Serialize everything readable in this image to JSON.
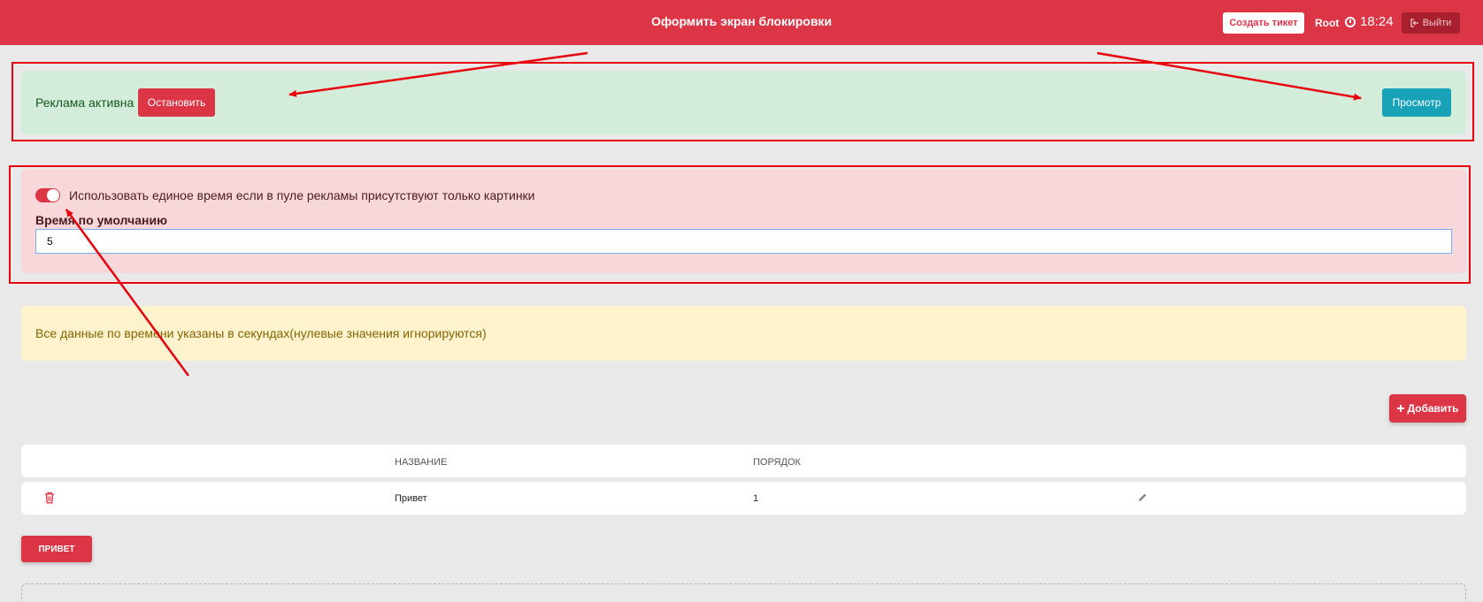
{
  "topbar": {
    "title": "Оформить экран блокировки",
    "ticket_label": "Создать тикет",
    "username": "Root",
    "time": "18:24",
    "logout_label": "Выйти"
  },
  "ad": {
    "status_label": "Реклама активна",
    "stop_label": "Остановить",
    "preview_label": "Просмотр"
  },
  "settings": {
    "toggle_label": "Использовать единое время если в пуле рекламы присутствуют только картинки",
    "default_time_label": "Время по умолчанию",
    "default_time_value": "5"
  },
  "info": {
    "text": "Все данные по времени указаны в секундах(нулевые значения игнорируются)"
  },
  "add_label": "Добавить",
  "table": {
    "columns": [
      "НАЗВАНИЕ",
      "ПОРЯДОК"
    ],
    "rows": [
      {
        "name": "Привет",
        "order": "1"
      }
    ]
  },
  "tag_label": "ПРИВЕТ",
  "colors": {
    "primary": "#dc3545",
    "info": "#17a2b8",
    "success_bg": "#d4edda",
    "danger_bg": "#f8d7da",
    "warning_bg": "#fff3cd"
  },
  "icons": [
    "clock-icon",
    "logout-icon",
    "plus-icon",
    "trash-icon",
    "pencil-icon"
  ]
}
